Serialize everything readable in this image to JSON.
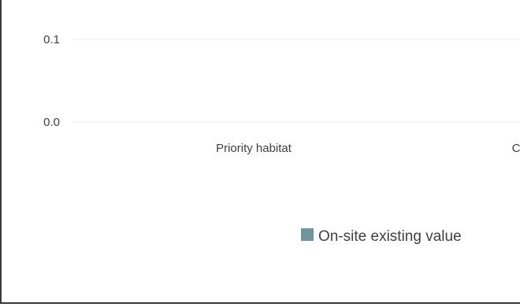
{
  "chart_data": {
    "type": "bar",
    "title": "",
    "xlabel": "",
    "ylabel": "",
    "categories": [
      "Priority habitat",
      "C"
    ],
    "y_ticks": [
      "0.1",
      "0.0"
    ],
    "ylim": [
      0,
      0.1
    ],
    "grid": true,
    "legend_position": "bottom",
    "series": [
      {
        "name": "On-site existing value",
        "values": [
          0,
          0
        ],
        "color": "#6f949d"
      }
    ],
    "gridline_color": "#ececec"
  }
}
